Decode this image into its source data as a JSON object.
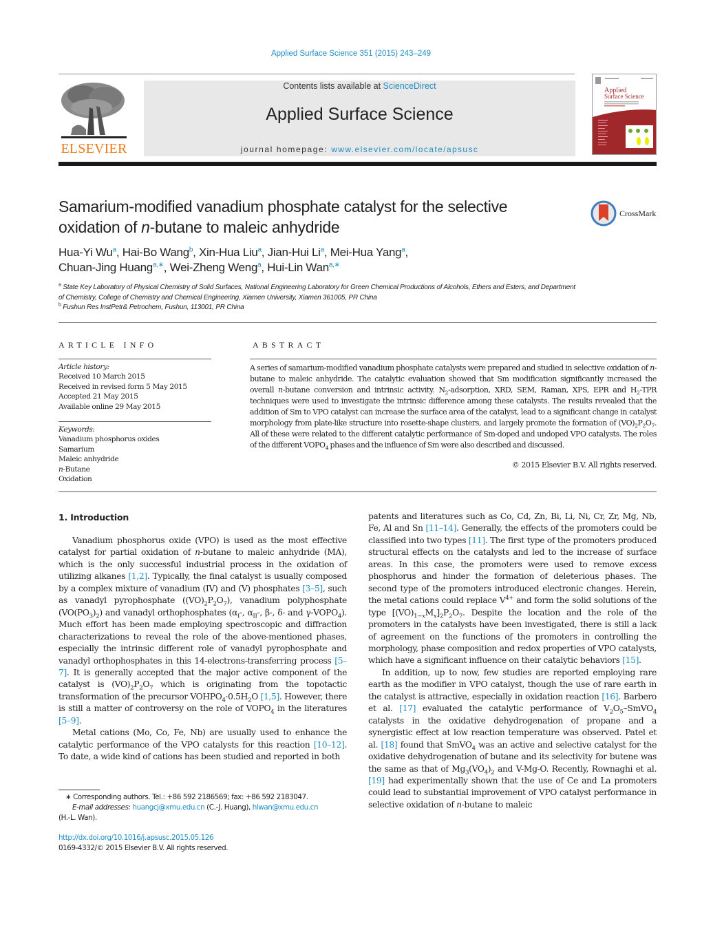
{
  "header": {
    "journal_ref": "Applied Surface Science 351 (2015) 243–249",
    "contents_prefix": "Contents lists available at ",
    "contents_link": "ScienceDirect",
    "journal_title": "Applied Surface Science",
    "homepage_prefix": "journal homepage: ",
    "homepage_link": "www.elsevier.com/locate/apsusc",
    "publisher_logo_text": "ELSEVIER",
    "cover_title_line1": "Applied",
    "cover_title_line2": "Surface Science"
  },
  "colors": {
    "link": "#1f8dc1",
    "elsevier_orange": "#f07b1c",
    "cover_red": "#a0282a",
    "masthead_gray": "#e8e8e8"
  },
  "article": {
    "title_part1": "Samarium-modified vanadium phosphate catalyst for the selective oxidation of ",
    "title_italic": "n",
    "title_part2": "-butane to maleic anhydride",
    "crossmark_label": "CrossMark",
    "authors": [
      {
        "name": "Hua-Yi Wu",
        "aff": "a",
        "sep": ", "
      },
      {
        "name": "Hai-Bo Wang",
        "aff": "b",
        "sep": ", "
      },
      {
        "name": "Xin-Hua Liu",
        "aff": "a",
        "sep": ", "
      },
      {
        "name": "Jian-Hui Li",
        "aff": "a",
        "sep": ", "
      },
      {
        "name": "Mei-Hua Yang",
        "aff": "a",
        "sep": ","
      },
      {
        "name": "Chuan-Jing Huang",
        "aff": "a,∗",
        "sep": ", "
      },
      {
        "name": "Wei-Zheng Weng",
        "aff": "a",
        "sep": ", "
      },
      {
        "name": "Hui-Lin Wan",
        "aff": "a,∗",
        "sep": ""
      }
    ],
    "affiliations": [
      {
        "mark": "a",
        "text": "State Key Laboratory of Physical Chemistry of Solid Surfaces, National Engineering Laboratory for Green Chemical Productions of Alcohols, Ethers and Esters, and Department of Chemistry, College of Chemistry and Chemical Engineering, Xiamen University, Xiamen 361005, PR China"
      },
      {
        "mark": "b",
        "text": "Fushun Res InstPetr& Petrochem, Fushun, 113001, PR China"
      }
    ]
  },
  "article_info": {
    "heading": "ARTICLE INFO",
    "history_label": "Article history:",
    "history": [
      "Received 10 March 2015",
      "Received in revised form 5 May 2015",
      "Accepted 21 May 2015",
      "Available online 29 May 2015"
    ],
    "keywords_label": "Keywords:",
    "keywords": [
      {
        "pre": "",
        "ital": "",
        "post": "Vanadium phosphorus oxides"
      },
      {
        "pre": "",
        "ital": "",
        "post": "Samarium"
      },
      {
        "pre": "",
        "ital": "",
        "post": "Maleic anhydride"
      },
      {
        "pre": "",
        "ital": "n",
        "post": "-Butane"
      },
      {
        "pre": "",
        "ital": "",
        "post": "Oxidation"
      }
    ]
  },
  "abstract": {
    "heading": "ABSTRACT",
    "s1": "A series of samarium-modified vanadium phosphate catalysts were prepared and studied in selective oxidation of ",
    "s2": "-butane to maleic anhydride. The catalytic evaluation showed that Sm modification significantly increased the overall ",
    "s3": "-butane conversion and intrinsic activity. N",
    "s4": "-adsorption, XRD, SEM, Raman, XPS, EPR and H",
    "s5": "-TPR techniques were used to investigate the intrinsic difference among these catalysts. The results revealed that the addition of Sm to VPO catalyst can increase the surface area of the catalyst, lead to a significant change in catalyst morphology from plate-like structure into rosette-shape clusters, and largely promote the formation of (VO)",
    "s6": ". All of these were related to the different catalytic performance of Sm-doped and undoped VPO catalysts. The roles of the different VOPO",
    "s7": " phases and the influence of Sm were also described and discussed.",
    "copyright": "© 2015 Elsevier B.V. All rights reserved."
  },
  "body": {
    "section_heading": "1.  Introduction",
    "refs": {
      "r1_2": "[1,2]",
      "r3_5": "[3–5]",
      "r5_7": "[5–7]",
      "r1_5": "[1,5]",
      "r5_9": "[5–9]",
      "r10_12": "[10–12]",
      "r11_14": "[11–14]",
      "r11": "[11]",
      "r15": "[15]",
      "r16": "[16]",
      "r17": "[17]",
      "r18": "[18]",
      "r19": "[19]"
    },
    "left_p1_a": "Vanadium phosphorus oxide (VPO) is used as the most effective catalyst for partial oxidation of ",
    "left_p1_b": "-butane to maleic anhydride (MA), which is the only successful industrial process in the oxidation of utilizing alkanes ",
    "left_p1_c": ". Typically, the final catalyst is usually composed by a complex mixture of vanadium (IV) and (V) phosphates ",
    "left_p1_d": ", such as vanadyl pyrophosphate ((VO)",
    "left_p1_e": "), vanadium polyphosphate (VO(PO",
    "left_p1_f": ") and vanadyl orthophosphates (α",
    "left_p1_g": "-, α",
    "left_p1_h": "-, β-, δ- and γ-VOPO",
    "left_p1_i": "). Much effort has been made employing spectroscopic and diffraction characterizations to reveal the role of the above-mentioned phases, especially the intrinsic different role of vanadyl pyrophosphate and vanadyl orthophosphates in this 14-electrons-transferring process ",
    "left_p1_j": ". It is generally accepted that the major active component of the catalyst is (VO)",
    "left_p1_k": " which is originating from the topotactic transformation of the precursor VOHPO",
    "left_p1_l": "·0.5H",
    "left_p1_m": "O ",
    "left_p1_n": ". However, there is still a matter of controversy on the role of VOPO",
    "left_p1_o": " in the literatures ",
    "left_p2_a": "Metal cations (Mo, Co, Fe, Nb) are usually used to enhance the catalytic performance of the VPO catalysts for this reaction ",
    "left_p2_b": ". To date, a wide kind of cations has been studied and reported in both",
    "right_p1_a": "patents and literatures such as Co, Cd, Zn, Bi, Li, Ni, Cr, Zr, Mg, Nb, Fe, Al and Sn ",
    "right_p1_b": ". Generally, the effects of the promoters could be classified into two types ",
    "right_p1_c": ". The first type of the promoters produced structural effects on the catalysts and led to the increase of surface areas. In this case, the promoters were used to remove excess phosphorus and hinder the formation of deleterious phases. The second type of the promoters introduced electronic changes. Herein, the metal cations could replace V",
    "right_p1_d": " and form the solid solutions of the type [(VO)",
    "right_p1_e": "M",
    "right_p1_f": "]",
    "right_p1_g": ". Despite the location and the role of the promoters in the catalysts have been investigated, there is still a lack of agreement on the functions of the promoters in controlling the morphology, phase composition and redox properties of VPO catalysts, which have a significant influence on their catalytic behaviors ",
    "right_p2_a": "In addition, up to now, few studies are reported employing rare earth as the modifier in VPO catalyst, though the use of rare earth in the catalyst is attractive, especially in oxidation reaction ",
    "right_p2_b": ". Barbero et al. ",
    "right_p2_c": " evaluated the catalytic performance of V",
    "right_p2_d": "–SmVO",
    "right_p2_e": " catalysts in the oxidative dehydrogenation of propane and a synergistic effect at low reaction temperature was observed. Patel et al. ",
    "right_p2_f": " found that SmVO",
    "right_p2_g": " was an active and selective catalyst for the oxidative dehydrogenation of butane and its selectivity for butene was the same as that of Mg",
    "right_p2_h": "(VO",
    "right_p2_i": " and V-Mg-O. Recently, Rownaghi et al. ",
    "right_p2_j": " had experimentally shown that the use of Ce and La promoters could lead to substantial improvement of VPO catalyst performance in selective oxidation of ",
    "right_p2_k": "-butane to maleic"
  },
  "footnotes": {
    "corresponding": "∗  Corresponding authors. Tel.: +86 592 2186569; fax: +86 592 2183047.",
    "email_label": "E-mail addresses: ",
    "email1": "huangcj@xmu.edu.cn",
    "email1_owner": " (C.-J. Huang), ",
    "email2": "hlwan@xmu.edu.cn",
    "email2_owner": "(H.-L. Wan).",
    "doi": "http://dx.doi.org/10.1016/j.apsusc.2015.05.126",
    "issn_copyright": "0169-4332/© 2015 Elsevier B.V. All rights reserved."
  }
}
